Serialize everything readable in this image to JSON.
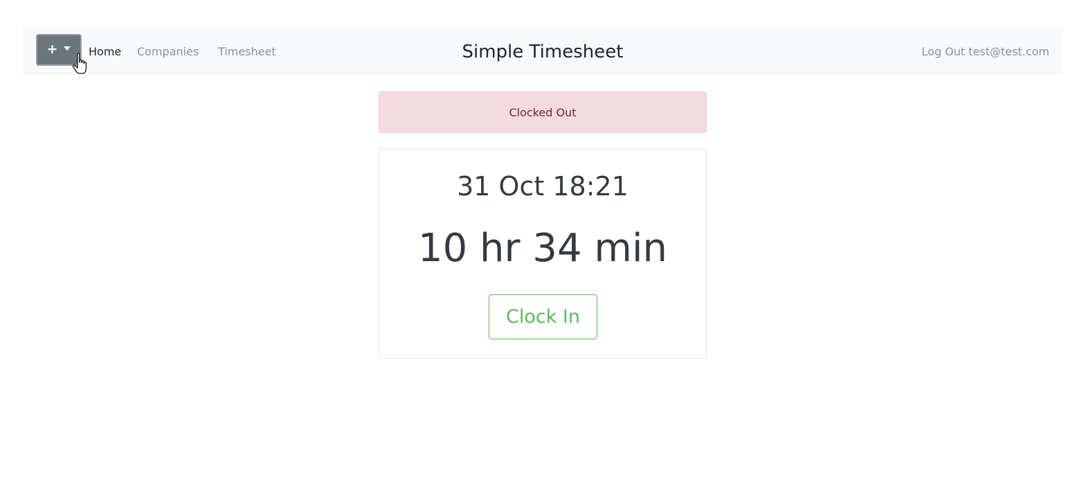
{
  "navbar": {
    "add_button": {
      "label": "+",
      "icon": "chevron-down-icon"
    },
    "links": [
      {
        "label": "Home",
        "active": true
      },
      {
        "label": "Companies",
        "active": false
      },
      {
        "label": "Timesheet",
        "active": false
      }
    ],
    "brand": "Simple Timesheet",
    "logout_label": "Log Out test@test.com"
  },
  "status": {
    "message": "Clocked Out",
    "color": "#f3dbe1"
  },
  "card": {
    "datetime": "31 Oct 18:21",
    "duration": "10 hr 34 min",
    "clock_in_label": "Clock In",
    "accent_color": "#5cb85c"
  },
  "cursor": {
    "icon": "hand-pointer-icon"
  }
}
